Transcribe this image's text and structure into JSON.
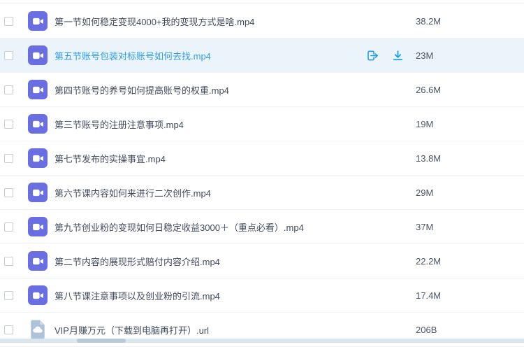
{
  "colors": {
    "accent": "#1b9ced",
    "highlight_row_bg": "#ecf4fb",
    "video_icon_bg": "#6a6ee3",
    "url_icon_bg": "#aec3d8",
    "name_color": "#414b5e",
    "name_highlight_color": "#2f9ced"
  },
  "icons": {
    "video_file": "video-camera-icon",
    "url_file": "cloud-document-icon",
    "share": "share-forward-icon",
    "download": "download-icon"
  },
  "list": {
    "rows": [
      {
        "name": "第一节如何稳定变现4000+我的变现方式是啥.mp4",
        "size": "38.2M",
        "type": "video",
        "highlighted": false,
        "actions": []
      },
      {
        "name": "第五节账号包装对标账号如何去找.mp4",
        "size": "23M",
        "type": "video",
        "highlighted": true,
        "actions": [
          "share",
          "download"
        ]
      },
      {
        "name": "第四节账号的养号如何提高账号的权重.mp4",
        "size": "26.6M",
        "type": "video",
        "highlighted": false,
        "actions": []
      },
      {
        "name": "第三节账号的注册注意事项.mp4",
        "size": "19M",
        "type": "video",
        "highlighted": false,
        "actions": []
      },
      {
        "name": "第七节发布的实操事宜.mp4",
        "size": "13.8M",
        "type": "video",
        "highlighted": false,
        "actions": []
      },
      {
        "name": "第六节课内容如何来进行二次创作.mp4",
        "size": "29M",
        "type": "video",
        "highlighted": false,
        "actions": []
      },
      {
        "name": "第九节创业粉的变现如何日稳定收益3000＋（重点必看）.mp4",
        "size": "37M",
        "type": "video",
        "highlighted": false,
        "actions": []
      },
      {
        "name": "第二节内容的展现形式赔付内容介绍.mp4",
        "size": "22.2M",
        "type": "video",
        "highlighted": false,
        "actions": []
      },
      {
        "name": "第八节课注意事项以及创业粉的引流.mp4",
        "size": "17.4M",
        "type": "video",
        "highlighted": false,
        "actions": []
      },
      {
        "name": "VIP月赚万元（下载到电脑再打开）.url",
        "size": "206B",
        "type": "url",
        "highlighted": false,
        "actions": []
      }
    ]
  }
}
